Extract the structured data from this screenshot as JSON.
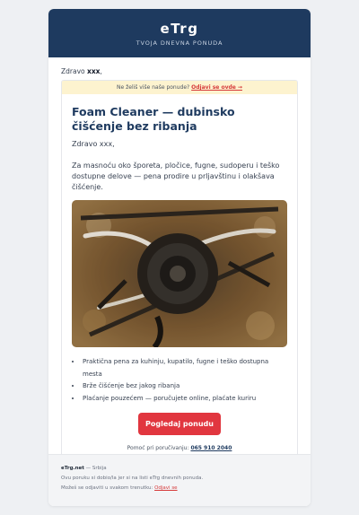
{
  "header": {
    "brand": "eTrg",
    "tagline": "TVOJA DNEVNA PONUDA"
  },
  "greeting": {
    "prefix": "Zdravo",
    "name": "xxx",
    "suffix": ","
  },
  "notice": {
    "text": "Ne želiš više naše ponude?",
    "link": "Odjavi se ovde →"
  },
  "offer": {
    "title": "Foam Cleaner — dubinsko čišćenje bez ribanja",
    "hello": "Zdravo xxx,",
    "description": "Za masnoću oko šporeta, pločice, fugne, sudoperu i teško dostupne delove — pena prodire u prljavštinu i olakšava čišćenje.",
    "image": "dirty-gas-stove-burner",
    "bullets": [
      "Praktična pena za kuhinju, kupatilo, fugne i teško dostupna mesta",
      "Brže čišćenje bez jakog ribanja",
      "Plaćanje pouzećem — poručujete online, plaćate kuriru"
    ],
    "cta": "Pogledaj ponudu",
    "help_text": "Pomoć pri poručivanju:",
    "phone": "065 910 2040"
  },
  "footer": {
    "brand": "eTrg.net",
    "location": "— Srbija",
    "line1": "Ovu poruku si dobio/la jer si na listi eTrg dnevnih ponuda.",
    "line2": "Možeš se odjaviti u svakom trenutku:",
    "unsubscribe": "Odjavi se"
  },
  "colors": {
    "header": "#1e3a5f",
    "accent": "#e1363f",
    "notice_bg": "#fdf3cf"
  }
}
